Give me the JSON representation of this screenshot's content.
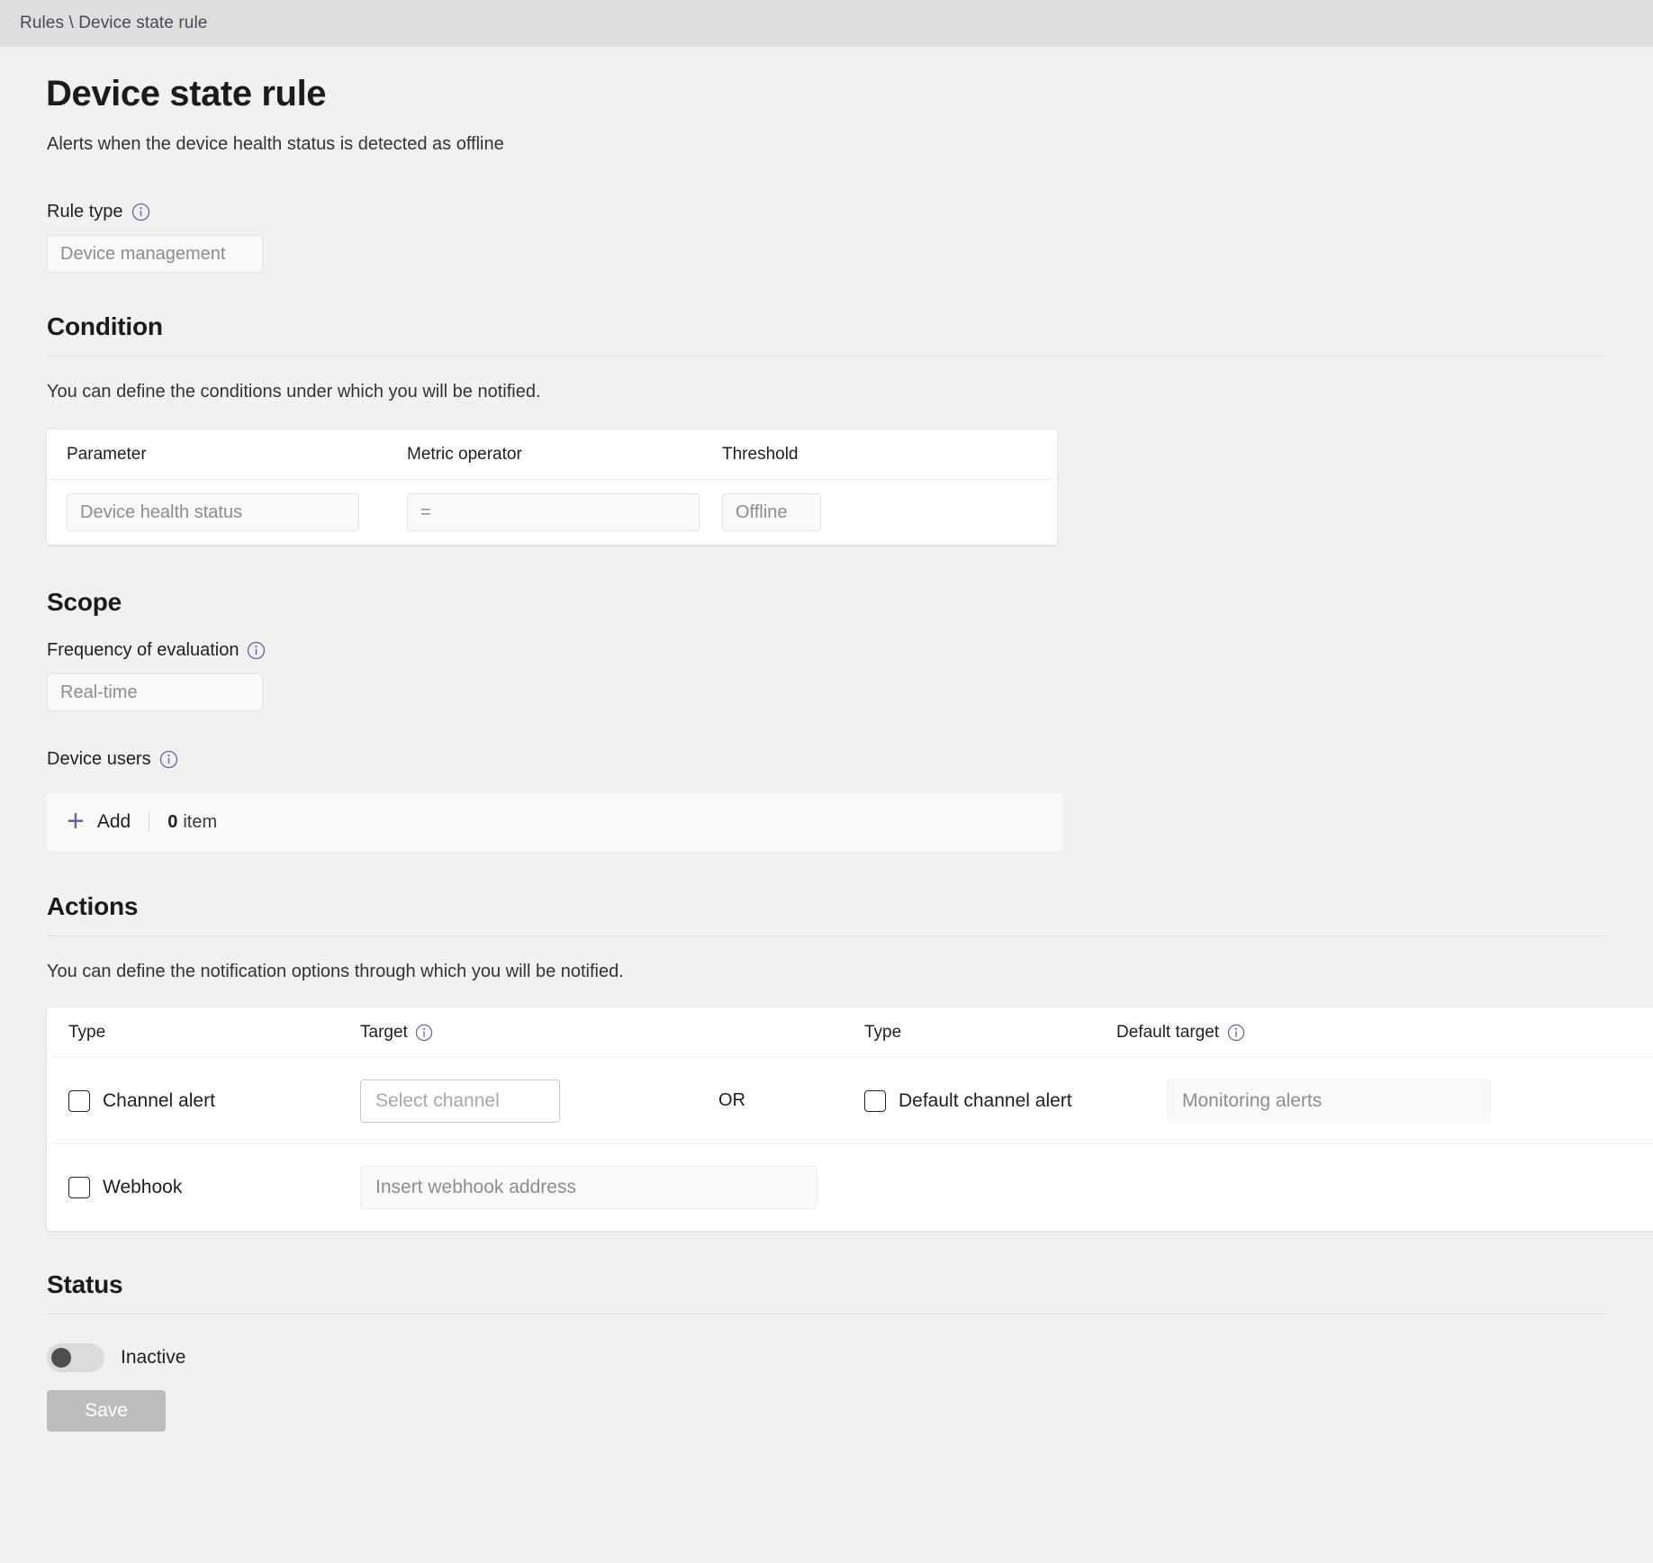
{
  "breadcrumb": {
    "parent": "Rules",
    "separator": "\\",
    "current": "Device state rule",
    "full": "Rules \\ Device state rule"
  },
  "header": {
    "title": "Device state rule",
    "subtitle": "Alerts when the device health status is detected as offline"
  },
  "rule_type": {
    "label": "Rule type",
    "info_icon": "info-circle-icon",
    "value": "Device management"
  },
  "condition": {
    "heading": "Condition",
    "description": "You can define the conditions under which you will be notified.",
    "columns": [
      "Parameter",
      "Metric operator",
      "Threshold"
    ],
    "row": {
      "parameter": "Device health status",
      "metric_operator": "=",
      "threshold": "Offline"
    }
  },
  "scope": {
    "heading": "Scope",
    "frequency": {
      "label": "Frequency of evaluation",
      "info_icon": "info-circle-icon",
      "value": "Real-time"
    },
    "device_users": {
      "label": "Device users",
      "info_icon": "info-circle-icon",
      "add_icon": "plus-icon",
      "add_label": "Add",
      "count": "0",
      "count_unit": "item"
    }
  },
  "actions": {
    "heading": "Actions",
    "description": "You can define the notification options through which you will be notified.",
    "columns": {
      "type": "Type",
      "target": "Target",
      "target_info_icon": "info-circle-icon",
      "type2": "Type",
      "default_target": "Default target",
      "default_target_info_icon": "info-circle-icon"
    },
    "rows": [
      {
        "checkbox_label": "Channel alert",
        "checked": false,
        "target_placeholder": "Select channel",
        "conjunction": "OR",
        "alt_checkbox_label": "Default channel alert",
        "alt_checked": false,
        "default_target_value": "Monitoring alerts"
      },
      {
        "checkbox_label": "Webhook",
        "checked": false,
        "target_placeholder": "Insert webhook address"
      }
    ]
  },
  "status": {
    "heading": "Status",
    "toggle_state": "off",
    "toggle_label": "Inactive",
    "save_label": "Save"
  },
  "colors": {
    "breadcrumb_bar": "#dedede",
    "page_background": "#f2f1f0",
    "accent": "#6264a7",
    "card_background": "#ffffff",
    "disabled_field": "#faf9f8",
    "save_disabled": "#bdbdbd"
  }
}
